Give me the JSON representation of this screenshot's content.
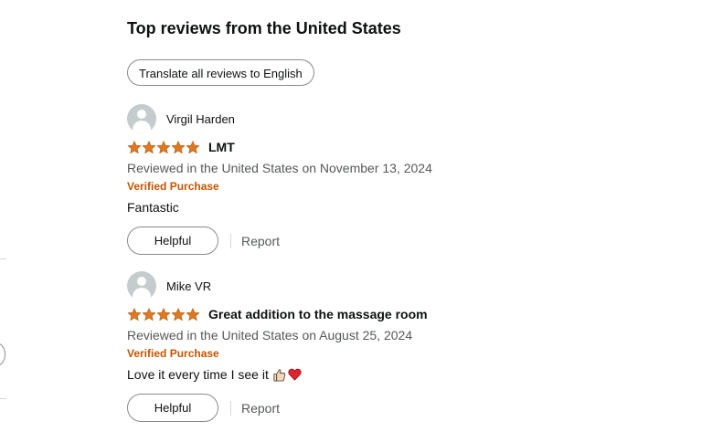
{
  "section": {
    "title": "Top reviews from the United States",
    "translate_button": "Translate all reviews to English"
  },
  "colors": {
    "star": "#de7921",
    "verified": "#c45500",
    "secondary_text": "#565959",
    "button_border": "#888c8c"
  },
  "reviews": [
    {
      "author": "Virgil Harden",
      "rating": 5,
      "rating_max": 5,
      "title": "LMT",
      "date": "Reviewed in the United States on November 13, 2024",
      "verified": "Verified Purchase",
      "body": "Fantastic",
      "emojis": [],
      "helpful_label": "Helpful",
      "report_label": "Report"
    },
    {
      "author": "Mike VR",
      "rating": 5,
      "rating_max": 5,
      "title": "Great addition to the massage room",
      "date": "Reviewed in the United States on August 25, 2024",
      "verified": "Verified Purchase",
      "body": "Love it every time I see it",
      "emojis": [
        "thumbs-up-icon",
        "red-heart-icon"
      ],
      "helpful_label": "Helpful",
      "report_label": "Report"
    }
  ]
}
